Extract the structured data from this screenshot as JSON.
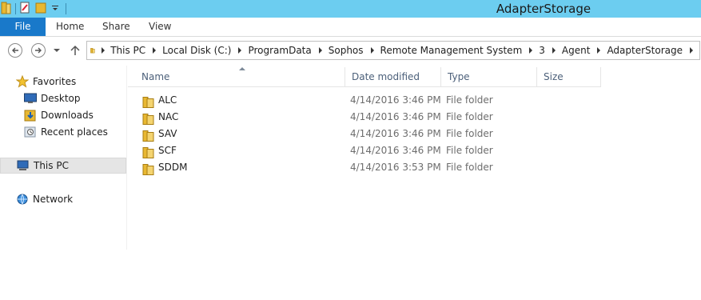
{
  "window": {
    "title": "AdapterStorage"
  },
  "ribbon": {
    "tabs": [
      "File",
      "Home",
      "Share",
      "View"
    ]
  },
  "address": {
    "crumbs": [
      "This PC",
      "Local Disk (C:)",
      "ProgramData",
      "Sophos",
      "Remote Management System",
      "3",
      "Agent",
      "AdapterStorage"
    ]
  },
  "nav": {
    "favorites": "Favorites",
    "desktop": "Desktop",
    "downloads": "Downloads",
    "recent": "Recent places",
    "thispc": "This PC",
    "network": "Network"
  },
  "columns": {
    "name": "Name",
    "date": "Date modified",
    "type": "Type",
    "size": "Size"
  },
  "files": [
    {
      "name": "ALC",
      "date": "4/14/2016 3:46 PM",
      "type": "File folder"
    },
    {
      "name": "NAC",
      "date": "4/14/2016 3:46 PM",
      "type": "File folder"
    },
    {
      "name": "SAV",
      "date": "4/14/2016 3:46 PM",
      "type": "File folder"
    },
    {
      "name": "SCF",
      "date": "4/14/2016 3:46 PM",
      "type": "File folder"
    },
    {
      "name": "SDDM",
      "date": "4/14/2016 3:53 PM",
      "type": "File folder"
    }
  ],
  "colors": {
    "titlebar": "#6ccdf0",
    "file_tab": "#1979ca",
    "folder": "#e8b832"
  },
  "icons": [
    "folder-icon",
    "properties-icon",
    "dropdown-icon",
    "back-icon",
    "forward-icon",
    "up-icon",
    "star-icon",
    "desktop-icon",
    "downloads-icon",
    "recent-icon",
    "computer-icon",
    "network-icon"
  ]
}
